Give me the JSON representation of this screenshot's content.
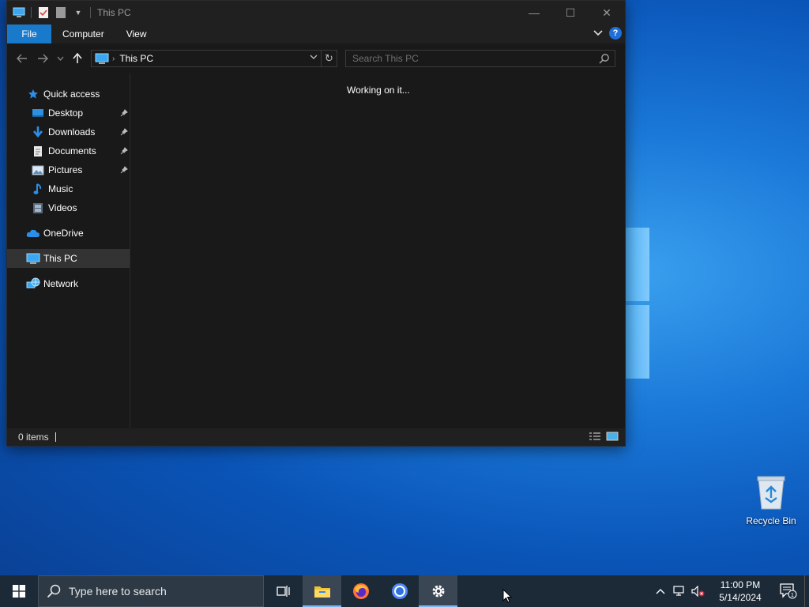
{
  "window": {
    "title": "This PC",
    "ribbon_tabs": [
      "File",
      "Computer",
      "View"
    ],
    "help_label": "?",
    "address": {
      "crumb": "This PC"
    },
    "search": {
      "placeholder": "Search This PC"
    },
    "nav": {
      "quick_access": "Quick access",
      "items": [
        {
          "label": "Desktop",
          "pinned": true
        },
        {
          "label": "Downloads",
          "pinned": true
        },
        {
          "label": "Documents",
          "pinned": true
        },
        {
          "label": "Pictures",
          "pinned": true
        },
        {
          "label": "Music",
          "pinned": false
        },
        {
          "label": "Videos",
          "pinned": false
        }
      ],
      "onedrive": "OneDrive",
      "this_pc": "This PC",
      "network": "Network"
    },
    "content_status": "Working on it...",
    "status": {
      "item_count": "0 items"
    }
  },
  "desktop": {
    "recycle_bin_label": "Recycle Bin"
  },
  "taskbar": {
    "search_placeholder": "Type here to search",
    "clock_time": "11:00 PM",
    "clock_date": "5/14/2024",
    "notification_count": "1"
  },
  "colors": {
    "accent": "#1979ca",
    "window_bg": "#191919",
    "taskbar_bg": "#1c2a38"
  }
}
